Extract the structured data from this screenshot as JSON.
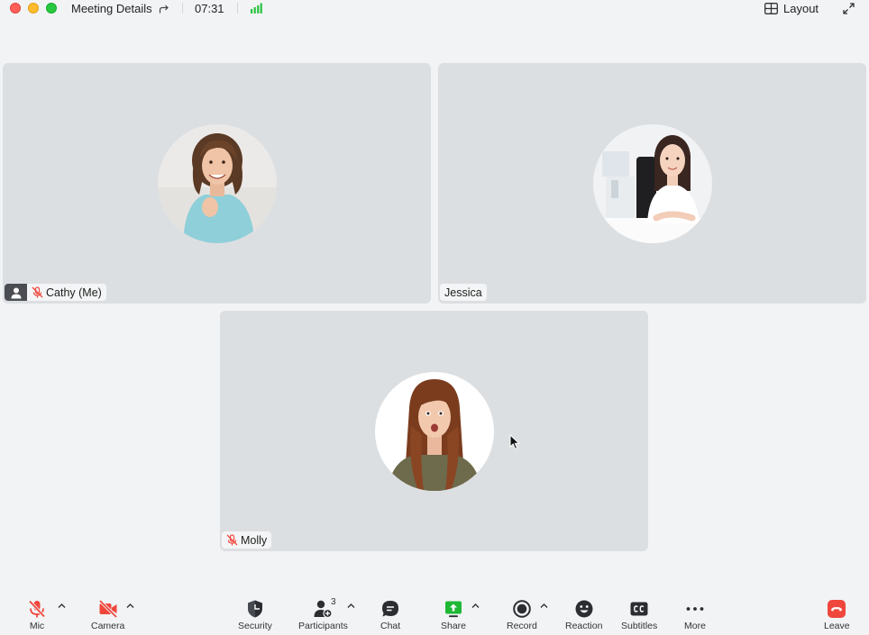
{
  "titlebar": {
    "meeting_details": "Meeting Details",
    "timer": "07:31",
    "layout_label": "Layout"
  },
  "participants": [
    {
      "name": "Cathy",
      "suffix": "(Me)",
      "muted": true
    },
    {
      "name": "Jessica",
      "muted": false
    },
    {
      "name": "Molly",
      "muted": true
    }
  ],
  "toolbar": {
    "mic": "Mic",
    "camera": "Camera",
    "security": "Security",
    "participants": "Participants",
    "participants_count": "3",
    "chat": "Chat",
    "share": "Share",
    "record": "Record",
    "reaction": "Reaction",
    "subtitles": "Subtitles",
    "more": "More",
    "leave": "Leave"
  },
  "colors": {
    "danger": "#f0473d",
    "share_green": "#1fb835",
    "signal_green": "#27c23d",
    "tile_bg": "#dcdfe2"
  }
}
